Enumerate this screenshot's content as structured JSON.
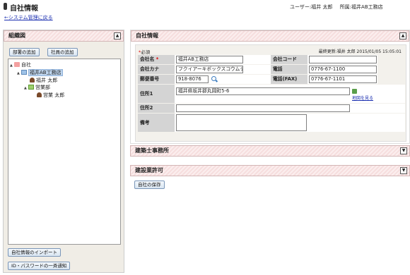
{
  "header": {
    "title": "自社情報",
    "back_link": "←システム管理に戻る",
    "user": "ユーザー:福井 太郎",
    "affiliation": "所属:福井AB工務店"
  },
  "left": {
    "panel_title": "組織図",
    "add_department": "部署の追加",
    "add_employee": "社員の追加",
    "tree": {
      "root": "自社",
      "company": "福井AB工務店",
      "person1": "福井 太郎",
      "dept": "営業部",
      "person2": "営業 太郎"
    },
    "import_button": "自社情報のインポート",
    "notify_button": "ID・パスワードの一斉通知"
  },
  "main": {
    "panel_title": "自社情報",
    "required_note": "必須",
    "last_updated": "最終更新:福井 太郎  2015/01/05 15:05:01",
    "fields": {
      "company_name_label": "会社名",
      "company_name": "福井AB工務店",
      "company_code_label": "会社コード",
      "company_code": "",
      "kana_label": "会社カナ",
      "kana": "フクイアーキボックスコウムテン",
      "phone_label": "電話",
      "phone": "0776-67-1100",
      "zip_label": "郵便番号",
      "zip": "918-8076",
      "fax_label": "電話(FAX)",
      "fax": "0776-67-1101",
      "address1_label": "住所1",
      "address1": "福井県坂井郡丸岡町5-6",
      "map_link": "地図を見る",
      "address2_label": "住所2",
      "address2": "",
      "notes_label": "備考",
      "notes": ""
    }
  },
  "sections": {
    "architect": "建築士事務所",
    "license": "建設業許可"
  },
  "save_button": "自社の保存",
  "icons": {
    "toggle_up": "▲",
    "toggle_down": "▼",
    "expand": "▲",
    "collapse": "▼"
  },
  "colors": {
    "panel_header": "#f6dede",
    "link": "#1b2fb0",
    "required": "#dd0000"
  }
}
